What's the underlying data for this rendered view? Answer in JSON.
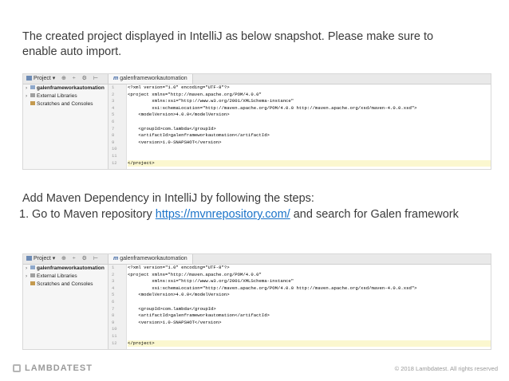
{
  "paragraph1": "The created project displayed in IntelliJ as below snapshot. Please make sure to enable auto import.",
  "paragraph2": "Add Maven Dependency in IntelliJ by following the steps:",
  "step1": {
    "number": "1.",
    "before": "Go to Maven repository ",
    "link": "https://mvnrepository.com/",
    "after": " and search for Galen framework"
  },
  "ide": {
    "project_label": "Project",
    "tab_label": "galenframeworkautomation",
    "tree": [
      "galenframeworkautomation",
      "External Libraries",
      "Scratches and Consoles"
    ],
    "line_numbers": [
      "1",
      "2",
      "3",
      "4",
      "5",
      "6",
      "7",
      "8",
      "9",
      "10",
      "11",
      "12"
    ],
    "code": [
      "<?xml version=\"1.0\" encoding=\"UTF-8\"?>",
      "<project xmlns=\"http://maven.apache.org/POM/4.0.0\"",
      "         xmlns:xsi=\"http://www.w3.org/2001/XMLSchema-instance\"",
      "         xsi:schemaLocation=\"http://maven.apache.org/POM/4.0.0 http://maven.apache.org/xsd/maven-4.0.0.xsd\">",
      "    <modelVersion>4.0.0</modelVersion>",
      "",
      "    <groupId>com.lambda</groupId>",
      "    <artifactId>galenframeworkautomation</artifactId>",
      "    <version>1.0-SNAPSHOT</version>",
      "",
      "",
      "</project>"
    ]
  },
  "footer": {
    "brand": "LAMBDATEST",
    "copyright": "© 2018 Lambdatest. All rights reserved"
  }
}
